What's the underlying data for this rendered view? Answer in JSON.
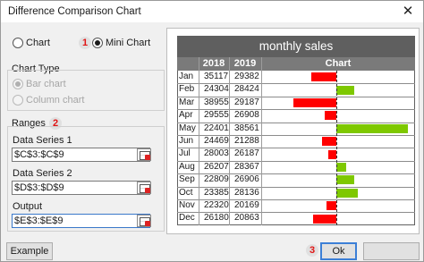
{
  "window": {
    "title": "Difference Comparison Chart",
    "close_glyph": "✕"
  },
  "mode": {
    "options": [
      {
        "label": "Chart",
        "selected": false
      },
      {
        "label": "Mini Chart",
        "selected": true
      }
    ],
    "step_badge": "1"
  },
  "chart_type": {
    "heading": "Chart Type",
    "options": [
      {
        "label": "Bar chart",
        "selected": true,
        "enabled": false
      },
      {
        "label": "Column chart",
        "selected": false,
        "enabled": false
      }
    ]
  },
  "ranges": {
    "heading": "Ranges",
    "step_badge": "2",
    "fields": [
      {
        "label": "Data Series 1",
        "value": "$C$3:$C$9"
      },
      {
        "label": "Data Series 2",
        "value": "$D$3:$D$9"
      },
      {
        "label": "Output",
        "value": "$E$3:$E$9"
      }
    ]
  },
  "buttons": {
    "example": "Example",
    "ok": "Ok",
    "ok_step_badge": "3"
  },
  "colors": {
    "negative": "#ff0000",
    "positive": "#7ec800",
    "header_dark": "#5f5f5f",
    "header_mid": "#7a7a7a",
    "accent": "#3c7fd6"
  },
  "preview": {
    "sheet_title": "monthly sales",
    "headers": [
      "",
      "2018",
      "2019",
      "Chart"
    ],
    "rows": [
      {
        "month": "Jan",
        "y2018": "35117",
        "y2019": "29382"
      },
      {
        "month": "Feb",
        "y2018": "24304",
        "y2019": "28424"
      },
      {
        "month": "Mar",
        "y2018": "38955",
        "y2019": "29187"
      },
      {
        "month": "Apr",
        "y2018": "29555",
        "y2019": "26908"
      },
      {
        "month": "May",
        "y2018": "22401",
        "y2019": "38561"
      },
      {
        "month": "Jun",
        "y2018": "24469",
        "y2019": "21288"
      },
      {
        "month": "Jul",
        "y2018": "28003",
        "y2019": "26187"
      },
      {
        "month": "Aug",
        "y2018": "26207",
        "y2019": "28367"
      },
      {
        "month": "Sep",
        "y2018": "22809",
        "y2019": "26906"
      },
      {
        "month": "Oct",
        "y2018": "23385",
        "y2019": "28136"
      },
      {
        "month": "Nov",
        "y2018": "22320",
        "y2019": "20169"
      },
      {
        "month": "Dec",
        "y2018": "26180",
        "y2019": "20863"
      }
    ]
  }
}
